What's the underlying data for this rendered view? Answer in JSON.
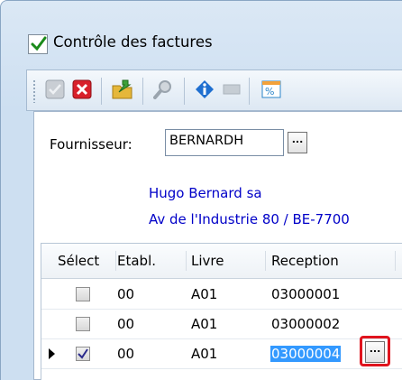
{
  "window": {
    "title": "Contrôle des factures"
  },
  "toolbar": {
    "buttons": [
      {
        "name": "validate",
        "icon": "check-icon"
      },
      {
        "name": "cancel",
        "icon": "close-icon"
      },
      {
        "name": "export",
        "icon": "folder-export-icon"
      },
      {
        "name": "search",
        "icon": "magnifier-icon"
      },
      {
        "name": "info",
        "icon": "info-icon"
      },
      {
        "name": "minimize",
        "icon": "dash-icon"
      },
      {
        "name": "percent",
        "icon": "percent-icon"
      }
    ]
  },
  "supplier": {
    "label": "Fournisseur:",
    "code": "BERNARDH",
    "browse_label": "...",
    "name": "Hugo Bernard sa",
    "address": "Av de l'Industrie 80 / BE-7700"
  },
  "grid": {
    "columns": [
      "Sélect",
      "Etabl.",
      "Livre",
      "Reception"
    ],
    "rows": [
      {
        "selected": false,
        "etabl": "00",
        "livre": "A01",
        "reception": "03000001",
        "current": false
      },
      {
        "selected": false,
        "etabl": "00",
        "livre": "A01",
        "reception": "03000002",
        "current": false
      },
      {
        "selected": true,
        "etabl": "00",
        "livre": "A01",
        "reception": "03000004",
        "current": true
      }
    ],
    "edit_browse_label": "..."
  },
  "colors": {
    "link_text": "#0000c8",
    "selection": "#3399ff",
    "highlight_ring": "#e0141e",
    "window_bg": "#cddff1"
  }
}
